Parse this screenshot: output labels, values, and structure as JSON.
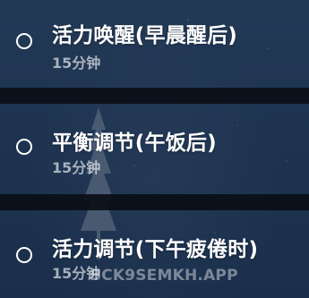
{
  "items": [
    {
      "title": "活力唤醒(早晨醒后)",
      "duration": "15分钟"
    },
    {
      "title": "平衡调节(午饭后)",
      "duration": "15分钟"
    },
    {
      "title": "活力调节(下午疲倦时)",
      "duration": "15分钟"
    }
  ],
  "watermark": "BCK9SEMKH.APP"
}
